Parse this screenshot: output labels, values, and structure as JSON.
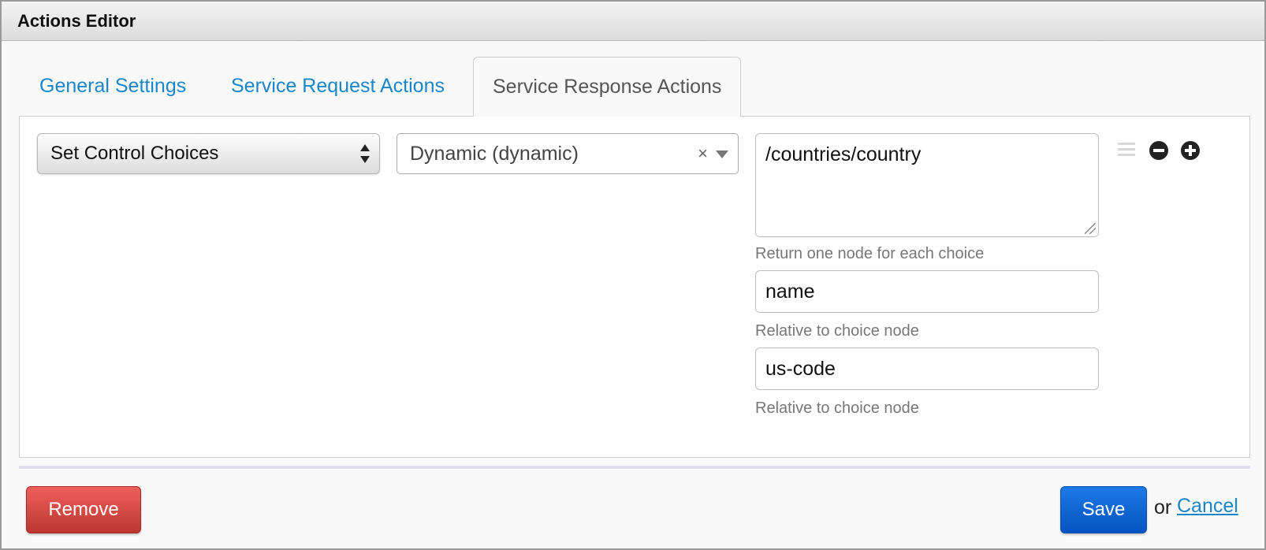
{
  "window": {
    "title": "Actions Editor"
  },
  "tabs": [
    {
      "label": "General Settings",
      "active": false
    },
    {
      "label": "Service Request Actions",
      "active": false
    },
    {
      "label": "Service Response Actions",
      "active": true
    }
  ],
  "action": {
    "type_select": {
      "value": "Set Control Choices"
    },
    "control_combo": {
      "value": "Dynamic (dynamic)",
      "clear_symbol": "×"
    },
    "choices_xpath": {
      "value": "/countries/country",
      "help": "Return one node for each choice"
    },
    "label_field": {
      "value": "name",
      "help": "Relative to choice node"
    },
    "value_field": {
      "value": "us-code",
      "help": "Relative to choice node"
    },
    "icons": [
      "drag-handle-icon",
      "minus-circle-icon",
      "plus-circle-icon"
    ]
  },
  "footer": {
    "remove_label": "Remove",
    "save_label": "Save",
    "or_text": "or",
    "cancel_label": "Cancel"
  },
  "colors": {
    "link": "#1a86c8",
    "remove": "#d9534f",
    "save": "#0d6ad8"
  }
}
